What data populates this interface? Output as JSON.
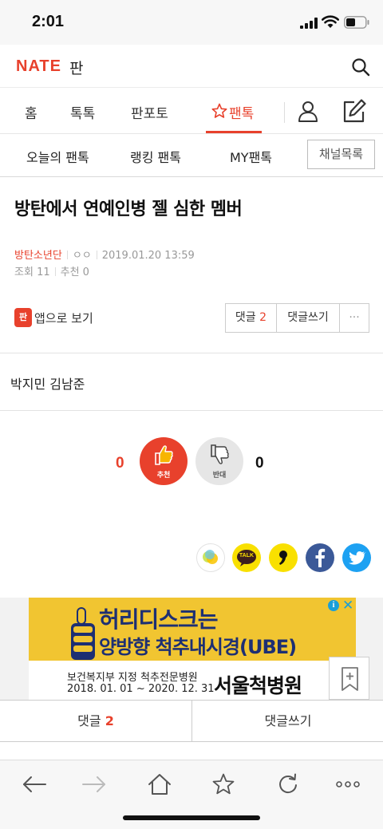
{
  "status_bar": {
    "time": "2:01"
  },
  "header": {
    "logo": "NATE",
    "service": "판"
  },
  "main_nav": {
    "tabs": [
      "홈",
      "톡톡",
      "판포토",
      "팬톡"
    ],
    "active_tab": "팬톡"
  },
  "sub_nav": {
    "items": [
      "오늘의 팬톡",
      "랭킹 팬톡",
      "MY팬톡"
    ],
    "channel_list": "채널목록"
  },
  "article": {
    "title": "방탄에서 연예인병 젤 심한 멤버",
    "author": "방탄소년단",
    "nickname": "ㅇㅇ",
    "date": "2019.01.20 13:59",
    "views_label": "조회",
    "views": "11",
    "recommend_label": "추천",
    "recommend": "0",
    "app_view": "앱으로 보기",
    "app_icon_text": "판",
    "body": "박지민 김남준"
  },
  "actions": {
    "comment_label": "댓글",
    "comment_count": "2",
    "write_comment": "댓글쓰기",
    "more": "···"
  },
  "votes": {
    "up_count": "0",
    "up_label": "추천",
    "down_count": "0",
    "down_label": "반대"
  },
  "share": {
    "icons": [
      "kakao-story-icon",
      "kakao-talk-icon",
      "quote-icon",
      "facebook-icon",
      "twitter-icon"
    ],
    "talk_text": "TALK"
  },
  "ad": {
    "headline1": "허리디스크는",
    "headline2": "양방향 척추내시경(UBE)",
    "line1": "보건복지부 지정 척추전문병원",
    "line2": "2018. 01. 01 ~ 2020. 12. 31",
    "hospital": "서울척병원",
    "info": "i",
    "close": "✕"
  },
  "comment_bar": {
    "comment_label": "댓글",
    "comment_count": "2",
    "write_comment": "댓글쓰기"
  },
  "toolbar": {
    "icons": [
      "back-icon",
      "forward-icon",
      "home-icon",
      "bookmark-star-icon",
      "reload-icon",
      "more-icon"
    ]
  },
  "colors": {
    "accent": "#e8412c",
    "ad_yellow": "#f1c531",
    "ad_navy": "#1d2f73",
    "facebook": "#3b5998",
    "twitter": "#1da1f2",
    "kakao": "#f9e000"
  }
}
